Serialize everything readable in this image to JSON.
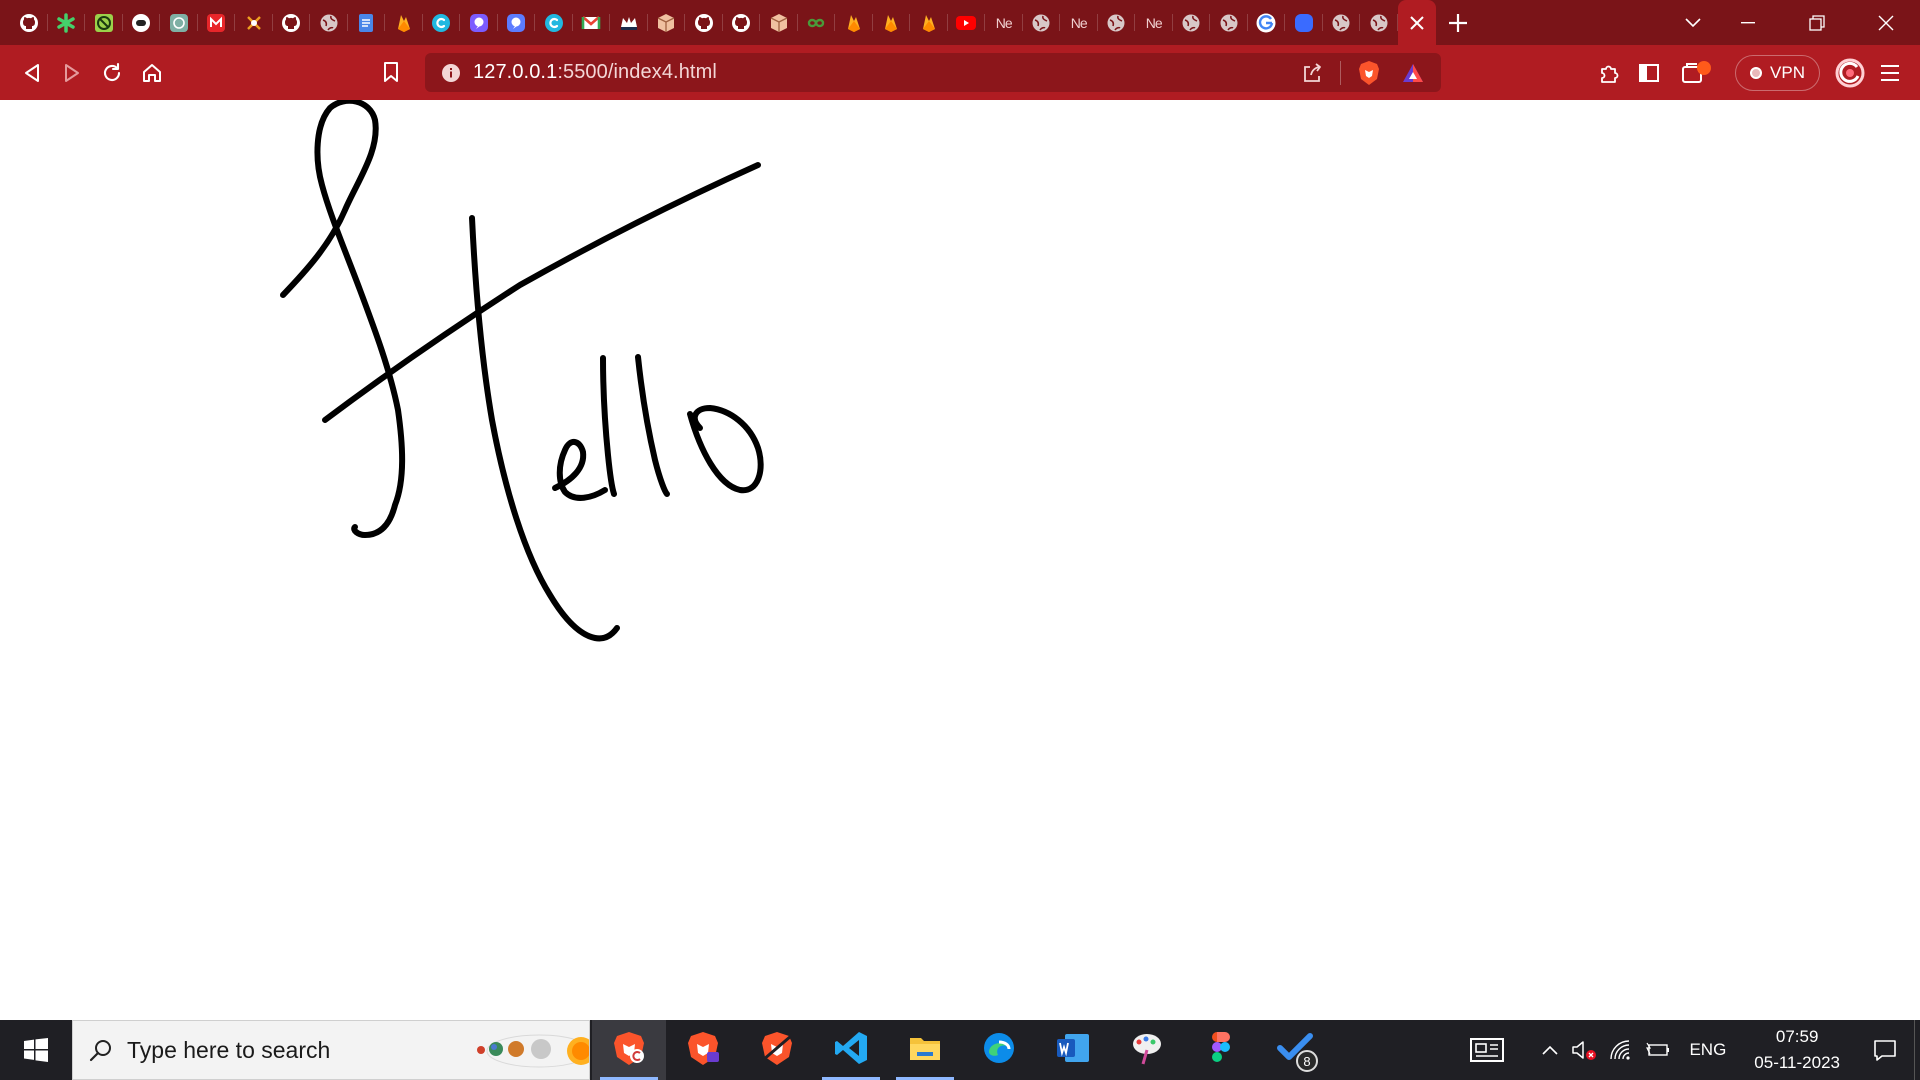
{
  "browser": {
    "url_host": "127.0.0.1",
    "url_path": ":5500/index4.html",
    "vpn_label": "VPN",
    "tabs": [
      {
        "icon": "github-icon",
        "color": "#ffffff"
      },
      {
        "icon": "asterisk-icon",
        "color": "#45d06a"
      },
      {
        "icon": "blocked-site-icon",
        "color": "#9bd14a"
      },
      {
        "icon": "chatbot-icon",
        "color": "#ffffff"
      },
      {
        "icon": "chatgpt-icon",
        "color": "#7fb0a4"
      },
      {
        "icon": "gmail-m-icon",
        "color": "#e8262a"
      },
      {
        "icon": "compass-icon",
        "color": "#f0a020"
      },
      {
        "icon": "github-icon",
        "color": "#ffffff"
      },
      {
        "icon": "globe-icon",
        "color": "#d8c8c8"
      },
      {
        "icon": "google-docs-icon",
        "color": "#4a86e8"
      },
      {
        "icon": "firebase-icon",
        "color": "#ffb020"
      },
      {
        "icon": "canva-icon",
        "color": "#21b8e0"
      },
      {
        "icon": "messenger-icon",
        "color": "#7b5cff"
      },
      {
        "icon": "messenger-icon",
        "color": "#5c7cff"
      },
      {
        "icon": "canva-icon",
        "color": "#21b8e0"
      },
      {
        "icon": "gmail-icon",
        "color": "#ea4335"
      },
      {
        "icon": "crown-icon",
        "color": "#1c2a4a"
      },
      {
        "icon": "package-icon",
        "color": "#f0c0a0"
      },
      {
        "icon": "github-icon",
        "color": "#ffffff"
      },
      {
        "icon": "github-icon",
        "color": "#ffffff"
      },
      {
        "icon": "package-icon",
        "color": "#f0c0a0"
      },
      {
        "icon": "infinity-icon",
        "color": "#4a9a3a"
      },
      {
        "icon": "firebase-icon",
        "color": "#ffb020"
      },
      {
        "icon": "firebase-icon",
        "color": "#ffb020"
      },
      {
        "icon": "firebase-icon",
        "color": "#ffb020"
      },
      {
        "icon": "youtube-icon",
        "color": "#ff0000"
      },
      {
        "icon": "text-tab",
        "label": "Ne"
      },
      {
        "icon": "globe-icon",
        "color": "#d8c8c8"
      },
      {
        "icon": "text-tab",
        "label": "Ne"
      },
      {
        "icon": "globe-icon",
        "color": "#d8c8c8"
      },
      {
        "icon": "text-tab",
        "label": "Ne"
      },
      {
        "icon": "globe-icon",
        "color": "#d8c8c8"
      },
      {
        "icon": "globe-icon",
        "color": "#d8c8c8"
      },
      {
        "icon": "google-icon",
        "color": "#ffffff"
      },
      {
        "icon": "blue-shield-icon",
        "color": "#3a6bff"
      },
      {
        "icon": "globe-icon",
        "color": "#d8c8c8"
      },
      {
        "icon": "globe-icon",
        "color": "#d8c8c8"
      },
      {
        "icon": "close-icon",
        "active": true
      }
    ]
  },
  "theme": {
    "tabstrip": "#7a1418",
    "toolbar": "#b01c22",
    "omnibox": "#8c161b",
    "ink": "#000000"
  },
  "taskbar": {
    "search_placeholder": "Type here to search",
    "apps": [
      {
        "icon": "brave-icon",
        "active": true,
        "running": true
      },
      {
        "icon": "brave-beta-icon",
        "running": false
      },
      {
        "icon": "brave-nightly-icon",
        "running": false
      },
      {
        "icon": "vscode-icon",
        "running": true
      },
      {
        "icon": "file-explorer-icon",
        "running": true
      },
      {
        "icon": "edge-icon",
        "running": false
      },
      {
        "icon": "word-icon",
        "running": false
      },
      {
        "icon": "paint-icon",
        "running": false
      },
      {
        "icon": "figma-icon",
        "running": false
      },
      {
        "icon": "todo-icon",
        "running": false,
        "badge": "8"
      }
    ],
    "language": "ENG",
    "time": "07:59",
    "date": "05-11-2023"
  }
}
